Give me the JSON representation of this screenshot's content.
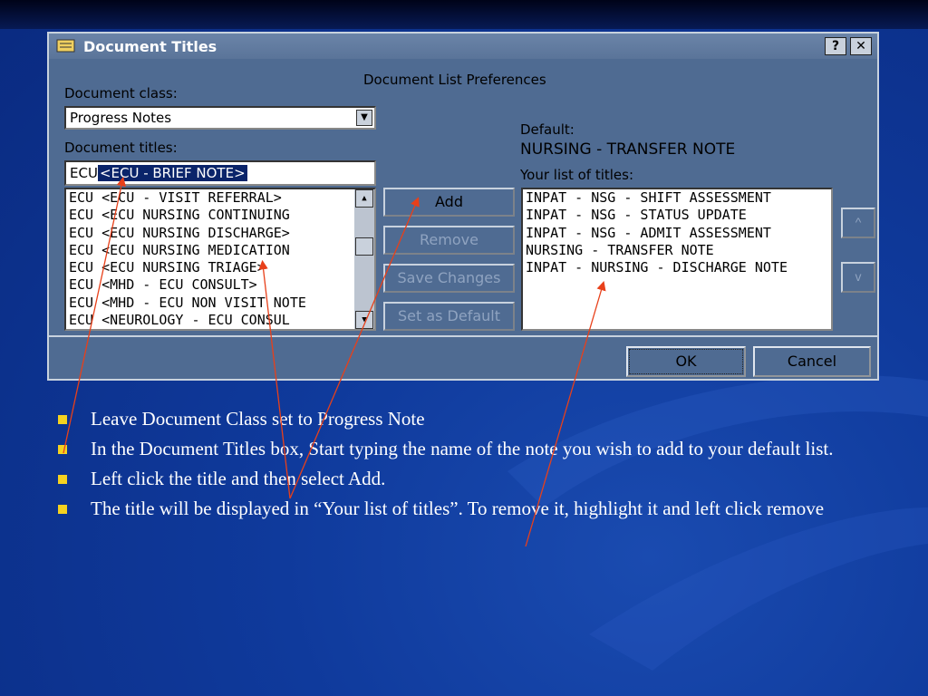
{
  "dialog": {
    "title": "Document Titles",
    "help_button": "?",
    "close_button": "✕",
    "header": "Document List Preferences",
    "document_class_label": "Document class:",
    "document_class_value": "Progress Notes",
    "document_titles_label": "Document titles:",
    "search_typed": "ECU",
    "search_suggestion": "<ECU - BRIEF NOTE>",
    "titles_list": [
      "ECU  <ECU - VISIT REFERRAL>",
      "ECU  <ECU NURSING CONTINUING",
      "ECU  <ECU NURSING DISCHARGE>",
      "ECU  <ECU NURSING MEDICATION",
      "ECU  <ECU NURSING TRIAGE>",
      "ECU  <MHD - ECU CONSULT>",
      "ECU  <MHD - ECU NON VISIT NOTE",
      "ECU  <NEUROLOGY - ECU CONSUL"
    ],
    "buttons": {
      "add": "Add",
      "remove": "Remove",
      "save_changes": "Save Changes",
      "set_as_default": "Set as Default",
      "move_up": "^",
      "move_down": "v",
      "ok": "OK",
      "cancel": "Cancel"
    },
    "default_label": "Default:",
    "default_value": "NURSING - TRANSFER NOTE",
    "your_list_label": "Your list of titles:",
    "your_list": [
      "INPAT - NSG - SHIFT ASSESSMENT",
      "INPAT - NSG - STATUS UPDATE",
      "INPAT - NSG - ADMIT ASSESSMENT",
      "NURSING - TRANSFER NOTE",
      "INPAT - NURSING - DISCHARGE NOTE"
    ]
  },
  "bullets": [
    "Leave Document Class set to Progress Note",
    "In the Document Titles box, Start typing the name of the note you wish to add to your default list.",
    "Left click the title and then select Add.",
    "The title will be displayed in “Your list of titles”.  To remove it, highlight it and left click remove"
  ],
  "colors": {
    "slide_bg": "#0f3a9c",
    "dialog_bg": "#4f6b92",
    "highlight": "#0a246a",
    "bullet": "#f5d220",
    "arrow": "#e8401a"
  }
}
